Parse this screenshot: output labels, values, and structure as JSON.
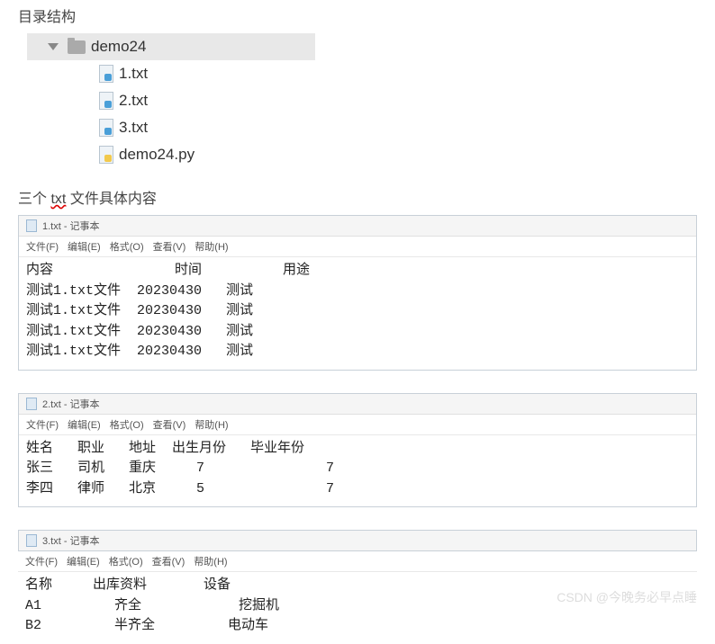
{
  "headings": {
    "dir_structure": "目录结构",
    "txt_intro_prefix": "三个",
    "txt_intro_word": "txt",
    "txt_intro_suffix": "文件具体内容"
  },
  "tree": {
    "folder": "demo24",
    "children": [
      {
        "label": "1.txt",
        "icon": "file"
      },
      {
        "label": "2.txt",
        "icon": "file"
      },
      {
        "label": "3.txt",
        "icon": "file"
      },
      {
        "label": "demo24.py",
        "icon": "py"
      }
    ]
  },
  "notepads": [
    {
      "title": "1.txt - 记事本",
      "menu": [
        "文件(F)",
        "编辑(E)",
        "格式(O)",
        "查看(V)",
        "帮助(H)"
      ],
      "rows": [
        "内容               时间          用途",
        "测试1.txt文件  20230430   测试",
        "测试1.txt文件  20230430   测试",
        "测试1.txt文件  20230430   测试",
        "测试1.txt文件  20230430   测试"
      ]
    },
    {
      "title": "2.txt - 记事本",
      "menu": [
        "文件(F)",
        "编辑(E)",
        "格式(O)",
        "查看(V)",
        "帮助(H)"
      ],
      "rows": [
        "姓名   职业   地址  出生月份   毕业年份",
        "张三   司机   重庆     7               7",
        "李四   律师   北京     5               7"
      ]
    },
    {
      "title": "3.txt - 记事本",
      "menu": [
        "文件(F)",
        "编辑(E)",
        "格式(O)",
        "查看(V)",
        "帮助(H)"
      ],
      "rows": [
        "名称     出库资料       设备",
        "A1         齐全            挖掘机",
        "B2         半齐全         电动车"
      ]
    }
  ],
  "watermark": "CSDN @今晚务必早点睡"
}
